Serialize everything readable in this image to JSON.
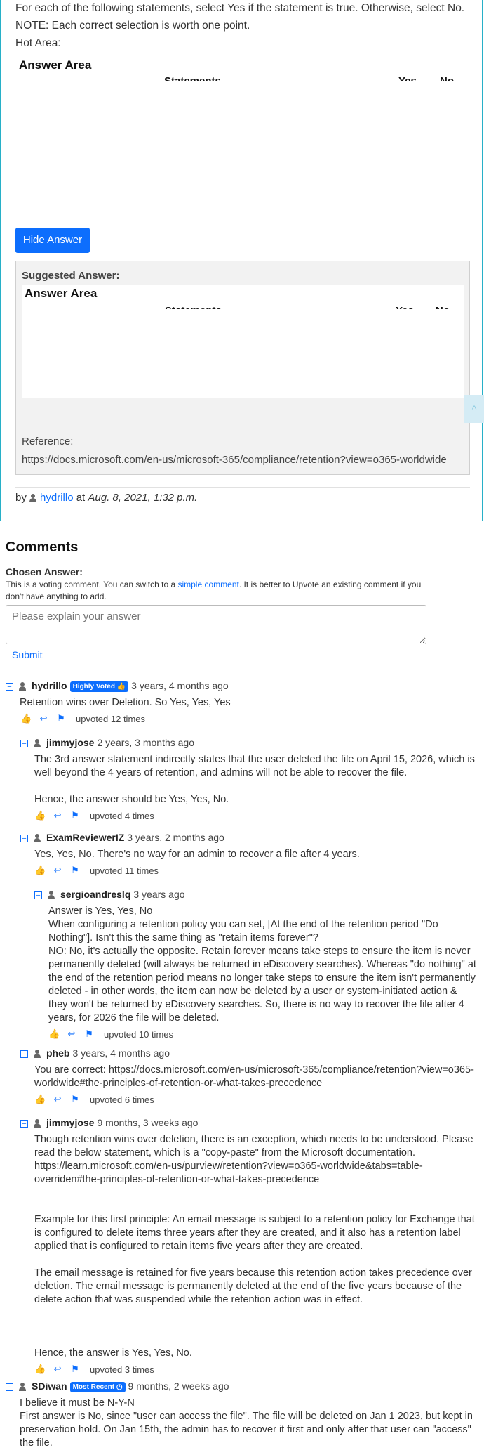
{
  "question": {
    "instruction_line1": "For each of the following statements, select Yes if the statement is true. Otherwise, select No.",
    "instruction_line2": "NOTE: Each correct selection is worth one point.",
    "hot_area_label": "Hot Area:",
    "answer_area_title": "Answer Area",
    "col_statements": "Statements",
    "col_yes": "Yes",
    "col_no": "No"
  },
  "hide_answer_button": "Hide Answer",
  "suggested": {
    "label": "Suggested Answer:",
    "answer_area_title": "Answer Area",
    "col_statements": "Statements",
    "col_yes": "Yes",
    "col_no": "No",
    "reference_label": "Reference:",
    "reference_url": "https://docs.microsoft.com/en-us/microsoft-365/compliance/retention?view=o365-worldwide"
  },
  "byline": {
    "by": "by",
    "user": "hydrillo",
    "at": "at",
    "date": "Aug. 8, 2021, 1:32 p.m."
  },
  "scroll_top_icon": "^",
  "comments": {
    "title": "Comments",
    "chosen_answer": "Chosen Answer:",
    "voting_note_pre": "This is a voting comment. You can switch to a",
    "voting_note_link": "simple comment",
    "voting_note_post": ". It is better to Upvote an existing comment if you don't have anything to add.",
    "input_placeholder": "Please explain your answer",
    "submit": "Submit",
    "list": [
      {
        "user": "hydrillo",
        "badge": "Highly Voted",
        "ago": "3 years, 4 months ago",
        "paragraphs": [
          "Retention wins over Deletion. So Yes, Yes, Yes"
        ],
        "upvotes": "upvoted 12 times"
      },
      {
        "user": "jimmyjose",
        "ago": "2 years, 3 months ago",
        "paragraphs": [
          "The 3rd answer statement indirectly states that the user deleted the file on April 15, 2026, which is well beyond the 4 years of retention, and admins will not be able to recover the file.",
          "Hence, the answer should be Yes, Yes, No."
        ],
        "upvotes": "upvoted 4 times"
      },
      {
        "user": "ExamReviewerIZ",
        "ago": "3 years, 2 months ago",
        "paragraphs": [
          "Yes, Yes, No. There's no way for an admin to recover a file after 4 years."
        ],
        "upvotes": "upvoted 11 times"
      },
      {
        "user": "sergioandreslq",
        "ago": "3 years ago",
        "paragraphs": [
          "Answer is Yes, Yes, No",
          "When configuring a retention policy you can set, [At the end of the retention period \"Do Nothing\"]. Isn't this the same thing as \"retain items forever\"?",
          "NO: No, it's actually the opposite. Retain forever means take steps to ensure the item is never permanently deleted (will always be returned in eDiscovery searches). Whereas \"do nothing\" at the end of the retention period means no longer take steps to ensure the item isn't permanently deleted - in other words, the item can now be deleted by a user or system-initiated action & they won't be returned by eDiscovery searches. So, there is no way to recover the file after 4 years, for 2026 the file will be deleted."
        ],
        "upvotes": "upvoted 10 times"
      },
      {
        "user": "pheb",
        "ago": "3 years, 4 months ago",
        "paragraphs": [
          "You are correct: https://docs.microsoft.com/en-us/microsoft-365/compliance/retention?view=o365-worldwide#the-principles-of-retention-or-what-takes-precedence"
        ],
        "upvotes": "upvoted 6 times"
      },
      {
        "user": "jimmyjose",
        "ago": "9 months, 3 weeks ago",
        "paragraphs": [
          "Though retention wins over deletion, there is an exception, which needs to be understood. Please read the below statement, which is a \"copy-paste\" from the Microsoft documentation. https://learn.microsoft.com/en-us/purview/retention?view=o365-worldwide&tabs=table-overriden#the-principles-of-retention-or-what-takes-precedence",
          "Example for this first principle: An email message is subject to a retention policy for Exchange that is configured to delete items three years after they are created, and it also has a retention label applied that is configured to retain items five years after they are created.",
          "The email message is retained for five years because this retention action takes precedence over deletion. The email message is permanently deleted at the end of the five years because of the delete action that was suspended while the retention action was in effect.",
          "Hence, the answer is Yes, Yes, No."
        ],
        "upvotes": "upvoted 3 times"
      },
      {
        "user": "SDiwan",
        "badge": "Most Recent",
        "ago": "9 months, 2 weeks ago",
        "paragraphs": [
          "I believe it must be N-Y-N",
          "First answer is No, since \"user can access the file\". The file will be deleted on Jan 1 2023, but kept in preservation hold. On Jan 15th, the admin has to recover it first and only after that user can \"access\" the file."
        ]
      }
    ]
  },
  "icons": {
    "collapse": "collapse-icon",
    "user": "user-icon",
    "upvote": "thumbs-up-icon",
    "reply": "reply-icon",
    "report": "flag-icon"
  },
  "accent_color": "#0d6efd",
  "card_border_color": "#27b0c8"
}
